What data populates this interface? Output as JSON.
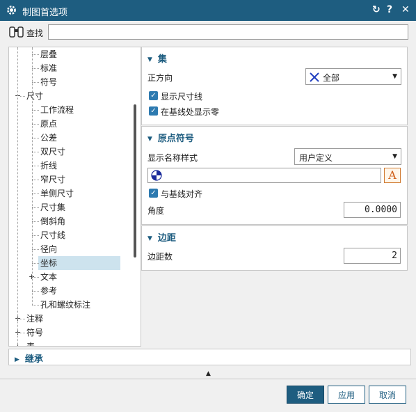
{
  "window": {
    "title": "制图首选项",
    "controls": [
      "↻",
      "?",
      "✕"
    ]
  },
  "search": {
    "label": "查找",
    "value": ""
  },
  "tree": {
    "items": [
      {
        "label": "层叠",
        "level": 2
      },
      {
        "label": "标准",
        "level": 2
      },
      {
        "label": "符号",
        "level": 2
      },
      {
        "label": "尺寸",
        "level": 1,
        "expander": "−"
      },
      {
        "label": "工作流程",
        "level": 2
      },
      {
        "label": "原点",
        "level": 2
      },
      {
        "label": "公差",
        "level": 2
      },
      {
        "label": "双尺寸",
        "level": 2
      },
      {
        "label": "折线",
        "level": 2
      },
      {
        "label": "窄尺寸",
        "level": 2
      },
      {
        "label": "单侧尺寸",
        "level": 2
      },
      {
        "label": "尺寸集",
        "level": 2
      },
      {
        "label": "倒斜角",
        "level": 2
      },
      {
        "label": "尺寸线",
        "level": 2
      },
      {
        "label": "径向",
        "level": 2
      },
      {
        "label": "坐标",
        "level": 2,
        "selected": true
      },
      {
        "label": "文本",
        "level": 2,
        "expander": "+"
      },
      {
        "label": "参考",
        "level": 2
      },
      {
        "label": "孔和螺纹标注",
        "level": 2
      },
      {
        "label": "注释",
        "level": 1,
        "expander": "+"
      },
      {
        "label": "符号",
        "level": 1,
        "expander": "+"
      },
      {
        "label": "表",
        "level": 1,
        "expander": "+"
      }
    ]
  },
  "section_set": {
    "title": "集",
    "orientation_label": "正方向",
    "orientation_value": "全部",
    "show_dim_line_label": "显示尺寸线",
    "show_dim_line_checked": true,
    "show_zero_label": "在基线处显示零",
    "show_zero_checked": true
  },
  "section_origin": {
    "title": "原点符号",
    "name_style_label": "显示名称样式",
    "name_style_value": "用户定义",
    "text_field_value": "",
    "align_label": "与基线对齐",
    "align_checked": true,
    "angle_label": "角度",
    "angle_value": "0.0000"
  },
  "section_margin": {
    "title": "边距",
    "count_label": "边距数",
    "count_value": "2"
  },
  "inherit": {
    "title": "继承"
  },
  "buttons": {
    "ok": "确定",
    "apply": "应用",
    "cancel": "取消"
  },
  "colors": {
    "titlebar": "#1e5d80",
    "accent": "#1e5d80",
    "selected_row": "#cde3ee",
    "checkbox": "#2d7ab0"
  }
}
